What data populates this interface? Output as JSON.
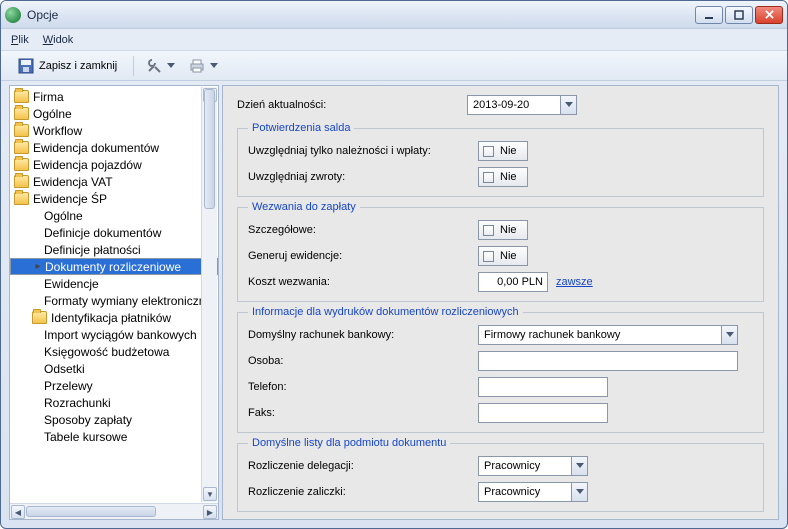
{
  "window": {
    "title": "Opcje"
  },
  "menu": {
    "file": "Plik",
    "view": "Widok"
  },
  "toolbar": {
    "save_close": "Zapisz i zamknij"
  },
  "tree": {
    "top": [
      "Firma",
      "Ogólne",
      "Workflow",
      "Ewidencja dokumentów",
      "Ewidencja pojazdów",
      "Ewidencja VAT"
    ],
    "sp_label": "Ewidencje ŚP",
    "sp_children": [
      "Ogólne",
      "Definicje dokumentów",
      "Definicje płatności",
      "Dokumenty rozliczeniowe",
      "Ewidencje",
      "Formaty wymiany elektronicznej",
      "Identyfikacja płatników",
      "Import wyciągów bankowych",
      "Księgowość budżetowa",
      "Odsetki",
      "Przelewy",
      "Rozrachunki",
      "Sposoby zapłaty",
      "Tabele kursowe"
    ]
  },
  "form": {
    "date_label": "Dzień aktualności:",
    "date_value": "2013-09-20",
    "group_saldo": "Potwierdzenia salda",
    "saldo_nalez": "Uwzględniaj tylko należności i wpłaty:",
    "saldo_zwroty": "Uwzględniaj zwroty:",
    "no": "Nie",
    "group_wezw": "Wezwania do zapłaty",
    "wezw_szcz": "Szczegółowe:",
    "wezw_gen": "Generuj ewidencje:",
    "wezw_koszt": "Koszt wezwania:",
    "wezw_koszt_val": "0,00 PLN",
    "wezw_link": "zawsze",
    "group_info": "Informacje dla wydruków dokumentów rozliczeniowych",
    "info_bank": "Domyślny rachunek bankowy:",
    "info_bank_val": "Firmowy rachunek bankowy",
    "info_osoba": "Osoba:",
    "info_tel": "Telefon:",
    "info_faks": "Faks:",
    "group_listy": "Domyślne listy dla podmiotu dokumentu",
    "listy_deleg": "Rozliczenie delegacji:",
    "listy_zalicz": "Rozliczenie zaliczki:",
    "listy_val": "Pracownicy"
  }
}
